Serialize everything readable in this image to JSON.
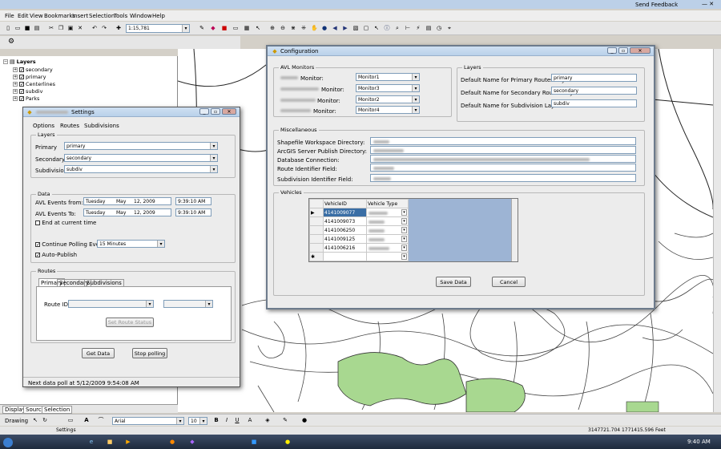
{
  "app": {
    "send_feedback": "Send Feedback"
  },
  "menu": [
    "File",
    "Edit",
    "View",
    "Bookmarks",
    "Insert",
    "Selection",
    "Tools",
    "Window",
    "Help"
  ],
  "toolbar": {
    "scale": "1:15,781"
  },
  "toc": {
    "root": "Layers",
    "layers": [
      "secondary",
      "primary",
      "Centerlines",
      "subdiv",
      "Parks"
    ],
    "tabs": [
      "Display",
      "Source",
      "Selection"
    ]
  },
  "drawing": {
    "label": "Drawing",
    "font": "Arial",
    "size": "10"
  },
  "status": {
    "coords": "3147721.704  1771415.596 Feet"
  },
  "taskbar": {
    "active_item": "Settings",
    "clock": "9:40 AM"
  },
  "settings": {
    "title": "Settings",
    "menu": [
      "Options",
      "Routes",
      "Subdivisions"
    ],
    "layers": {
      "legend": "Layers",
      "primary_label": "Primary",
      "primary_value": "primary",
      "secondary_label": "Secondary",
      "secondary_value": "secondary",
      "subdivisions_label": "Subdivisions",
      "subdivisions_value": "subdiv"
    },
    "data": {
      "legend": "Data",
      "from_label": "AVL Events from:",
      "to_label": "AVL Events To:",
      "from_dow": "Tuesday",
      "from_month": "May",
      "from_day": "12, 2009",
      "from_time": "9:39:10 AM",
      "to_dow": "Tuesday",
      "to_month": "May",
      "to_day": "12, 2009",
      "to_time": "9:39:10 AM",
      "end_current": "End at current time",
      "continue_label": "Continue Polling Every",
      "interval": "15 Minutes",
      "autopublish": "Auto-Publish"
    },
    "routes": {
      "legend": "Routes",
      "tabs": [
        "Primary",
        "Secondary",
        "Subdivisions"
      ],
      "route_id_label": "Route ID",
      "set_status": "Set Route Status"
    },
    "get_data": "Get Data",
    "stop_polling": "Stop polling",
    "status": "Next data poll at 5/12/2009 9:54:08 AM"
  },
  "config": {
    "title": "Configuration",
    "avl": {
      "legend": "AVL Monitors",
      "monitor_label": "Monitor:",
      "values": [
        "Monitor1",
        "Monitor3",
        "Monitor2",
        "Monitor4"
      ]
    },
    "layers": {
      "legend": "Layers",
      "primary_label": "Default Name for Primary Routes Layer:",
      "primary_value": "primary",
      "secondary_label": "Default Name for Secondary Routes Layer:",
      "secondary_value": "secondary",
      "subdiv_label": "Default Name for Subdivision Layer:",
      "subdiv_value": "subdiv"
    },
    "misc": {
      "legend": "Miscellaneous",
      "labels": [
        "Shapefile Workspace Directory:",
        "ArcGIS Server Publish Directory:",
        "Database Connection:",
        "Route Identifier Field:",
        "Subdivision Identifier Field:"
      ]
    },
    "vehicles": {
      "legend": "Vehicles",
      "columns": [
        "VehicleID",
        "Vehicle Type"
      ],
      "ids": [
        "4141009077",
        "4141009073",
        "4141006250",
        "4141009125",
        "4141006216"
      ]
    },
    "save": "Save Data",
    "cancel": "Cancel"
  }
}
